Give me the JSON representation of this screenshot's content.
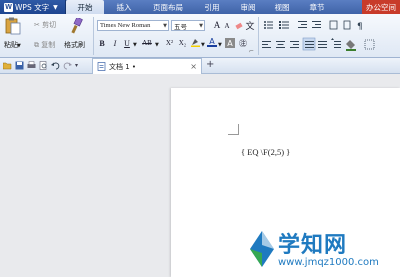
{
  "app": {
    "name": "WPS 文字"
  },
  "menu": {
    "tabs": [
      "开始",
      "插入",
      "页面布局",
      "引用",
      "审阅",
      "视图",
      "章节"
    ],
    "active_tab": 0,
    "office_space": "办公空间"
  },
  "ribbon": {
    "paste_label": "粘贴",
    "cut_label": "剪切",
    "copy_label": "复制",
    "format_painter_label": "格式刷",
    "font_name": "Times New Roman",
    "font_size": "五号",
    "bold": "B",
    "italic": "I",
    "underline": "U",
    "strike": "AB",
    "superscript": "X²",
    "subscript": "X₂",
    "grow_font": "A",
    "shrink_font": "A",
    "font_color": "A",
    "char_shading": "A",
    "paragraph_group_marker": "⌐"
  },
  "doc_tab": {
    "title": "文档 1 •"
  },
  "document": {
    "field_code": "{ EQ \\F(2,5) }"
  },
  "watermark": {
    "text": "学知网",
    "url": "www.jmqz1000.com"
  },
  "colors": {
    "menubar": "#4a6fb5",
    "app_button": "#1e4590",
    "accent_red": "#c83b2a",
    "workspace": "#e9eaed",
    "watermark": "#1f7ac0"
  }
}
